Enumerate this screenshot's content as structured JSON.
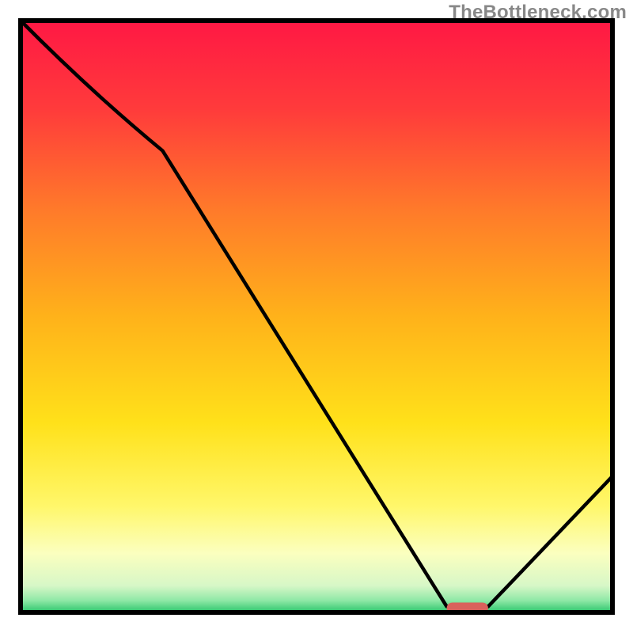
{
  "watermark": "TheBottleneck.com",
  "chart_data": {
    "type": "line",
    "title": "",
    "xlabel": "",
    "ylabel": "",
    "xlim": [
      0,
      100
    ],
    "ylim": [
      0,
      100
    ],
    "x": [
      0,
      24,
      72,
      79,
      100
    ],
    "values": [
      100,
      78,
      1,
      1,
      23
    ],
    "minimum_plateau": {
      "x_start": 72,
      "x_end": 79,
      "y": 1
    },
    "marker": {
      "x_center": 75,
      "y": 1,
      "color": "#d9615c"
    },
    "background_gradient": {
      "stops": [
        {
          "offset": 0.0,
          "color": "#ff1844"
        },
        {
          "offset": 0.15,
          "color": "#ff3b3b"
        },
        {
          "offset": 0.32,
          "color": "#ff7a2a"
        },
        {
          "offset": 0.5,
          "color": "#ffb21a"
        },
        {
          "offset": 0.68,
          "color": "#ffe11a"
        },
        {
          "offset": 0.82,
          "color": "#fff76a"
        },
        {
          "offset": 0.9,
          "color": "#fbffbf"
        },
        {
          "offset": 0.955,
          "color": "#d7f7c7"
        },
        {
          "offset": 0.98,
          "color": "#8ee8a6"
        },
        {
          "offset": 1.0,
          "color": "#28c46a"
        }
      ]
    },
    "frame": {
      "stroke": "#000000",
      "stroke_width": 6
    }
  }
}
